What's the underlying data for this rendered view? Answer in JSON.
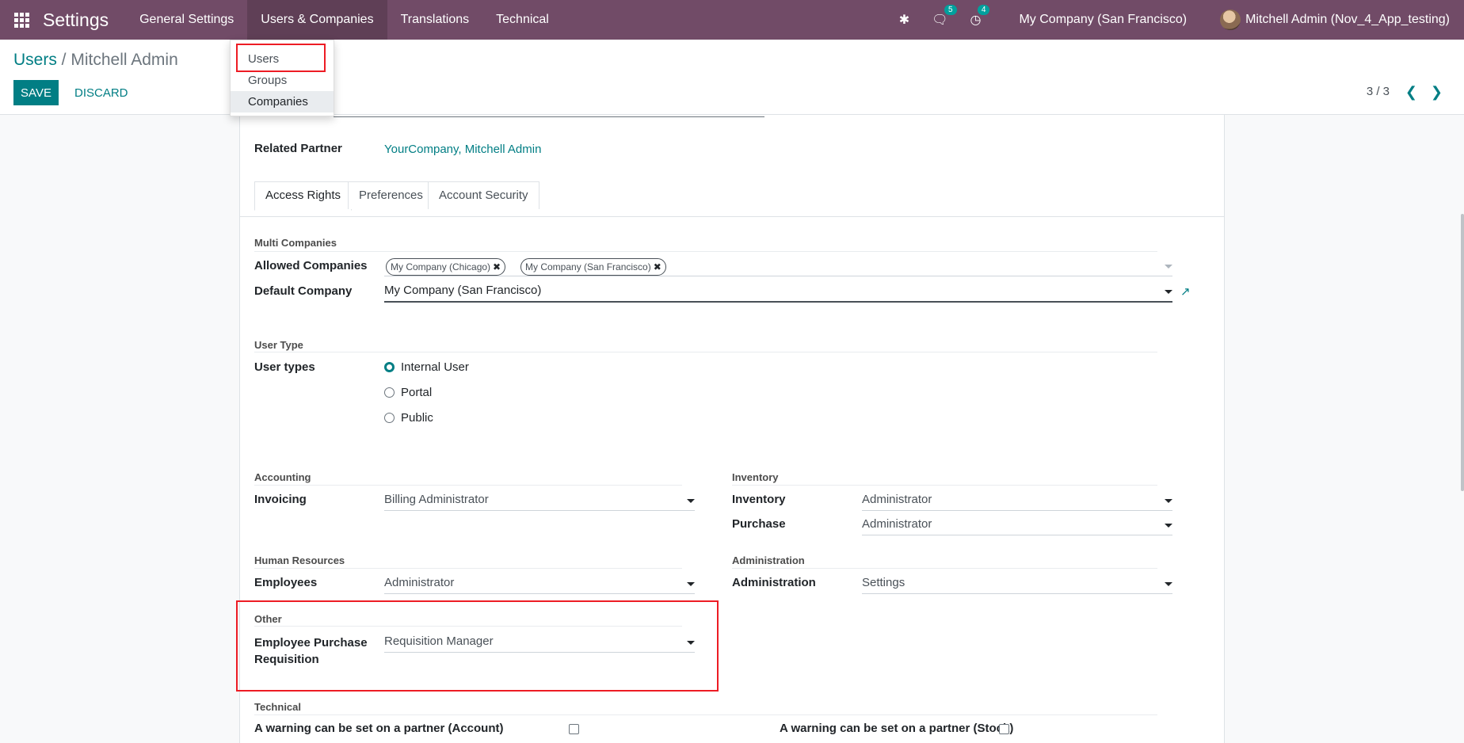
{
  "navbar": {
    "brand": "Settings",
    "menus": [
      "General Settings",
      "Users & Companies",
      "Translations",
      "Technical"
    ],
    "chat_badge": "5",
    "activity_badge": "4",
    "company": "My Company (San Francisco)",
    "user": "Mitchell Admin (Nov_4_App_testing)"
  },
  "dropdown": {
    "items": [
      "Users",
      "Groups",
      "Companies"
    ]
  },
  "control": {
    "breadcrumb_parent": "Users",
    "breadcrumb_sep": " / ",
    "breadcrumb_current": "Mitchell Admin",
    "save_label": "SAVE",
    "discard_label": "DISCARD",
    "pager": "3 / 3"
  },
  "form": {
    "related_partner_label": "Related Partner",
    "related_partner_value": "YourCompany, Mitchell Admin",
    "tabs": [
      "Access Rights",
      "Preferences",
      "Account Security"
    ],
    "multi_companies_title": "Multi Companies",
    "allowed_companies_label": "Allowed Companies",
    "allowed_companies": [
      "My Company (Chicago)",
      "My Company (San Francisco)"
    ],
    "default_company_label": "Default Company",
    "default_company_value": "My Company (San Francisco)",
    "user_type_title": "User Type",
    "user_types_label": "User types",
    "user_types": [
      "Internal User",
      "Portal",
      "Public"
    ],
    "user_type_selected": "Internal User",
    "accounting_title": "Accounting",
    "invoicing_label": "Invoicing",
    "invoicing_value": "Billing Administrator",
    "inventory_title": "Inventory",
    "inventory_label": "Inventory",
    "inventory_value": "Administrator",
    "purchase_label": "Purchase",
    "purchase_value": "Administrator",
    "hr_title": "Human Resources",
    "employees_label": "Employees",
    "employees_value": "Administrator",
    "administration_title": "Administration",
    "administration_label": "Administration",
    "administration_value": "Settings",
    "other_title": "Other",
    "epr_label_line1": "Employee Purchase",
    "epr_label_line2": "Requisition",
    "epr_value": "Requisition Manager",
    "technical_title": "Technical",
    "warning_account_label": "A warning can be set on a partner (Account)",
    "warning_stock_label": "A warning can be set on a partner (Stock)"
  },
  "colors": {
    "navbar": "#714b67",
    "accent": "#017e84",
    "highlight": "#ed1c24"
  },
  "icons": [
    "apps-grid-icon",
    "bug-icon",
    "chat-icon",
    "clock-icon",
    "external-link-icon",
    "chevron-left-icon",
    "chevron-right-icon"
  ]
}
